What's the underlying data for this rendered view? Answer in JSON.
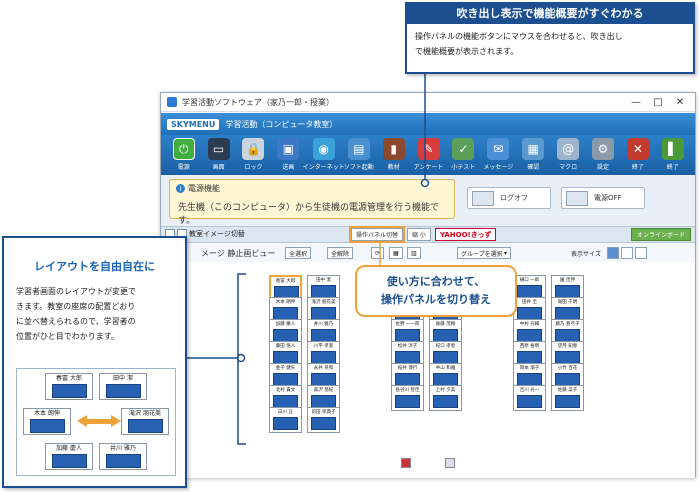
{
  "window": {
    "title": "学習活動ソフトウェア（家乃一郎・授業）",
    "controls": [
      "—",
      "□",
      "✕"
    ],
    "logo": "SKYMENU",
    "mode": "学習活動（コンピュータ教室）"
  },
  "toolbar": {
    "items": [
      {
        "label": "電源",
        "icon": "power-icon",
        "color": "#3fae3f",
        "glyph": "⏻"
      },
      {
        "label": "画面",
        "icon": "monitor-icon",
        "color": "#2a3b52",
        "glyph": "▭"
      },
      {
        "label": "ロック",
        "icon": "lock-icon",
        "color": "#c9d4de",
        "glyph": "🔒"
      },
      {
        "label": "送画",
        "icon": "display-icon",
        "color": "#3c78c4",
        "glyph": "▣"
      },
      {
        "label": "インターネット",
        "icon": "globe-icon",
        "color": "#3aa0d8",
        "glyph": "◉"
      },
      {
        "label": "ソフト起動",
        "icon": "software-icon",
        "color": "#4a90d0",
        "glyph": "▤"
      },
      {
        "label": "教材",
        "icon": "book-icon",
        "color": "#8b4a2f",
        "glyph": "▮"
      },
      {
        "label": "アンケート",
        "icon": "survey-icon",
        "color": "#d63c3c",
        "glyph": "✎"
      },
      {
        "label": "小テスト",
        "icon": "test-icon",
        "color": "#5aa05a",
        "glyph": "✓"
      },
      {
        "label": "メッセージ",
        "icon": "message-icon",
        "color": "#4b8fd6",
        "glyph": "✉"
      },
      {
        "label": "確認",
        "icon": "check-icon",
        "color": "#5a9ad0",
        "glyph": "▦"
      },
      {
        "label": "マクロ",
        "icon": "macro-icon",
        "color": "#9db4cc",
        "glyph": "@"
      },
      {
        "label": "設定",
        "icon": "gear-icon",
        "color": "#8a9aaa",
        "glyph": "⚙"
      },
      {
        "label": "終了",
        "icon": "tools-icon",
        "color": "#c23b2e",
        "glyph": "✕"
      },
      {
        "label": "終了",
        "icon": "exit-icon",
        "color": "#4a9a3a",
        "glyph": "▌"
      }
    ]
  },
  "infopanel": {
    "tooltip_title": "電源機能",
    "tooltip_desc": "先生機（このコンピュータ）から生徒機の電源管理を行う機能です。",
    "logoff_label": "ログオフ",
    "power_off_label": "電源OFF"
  },
  "viewbar": {
    "classroom_image": "教室イメージ切替",
    "panel_switch": "操作パネル切替",
    "shrink": "縮 小",
    "yahoo": "YAHOO!きっず",
    "online": "オンラインボード"
  },
  "contentbar": {
    "title": "メージ  静止画ビュー",
    "select_all": "全選択",
    "deselect_all": "全解除",
    "group_select": "グループを選択",
    "display_size": "表示サイズ"
  },
  "seats": [
    {
      "name": "春冨 大郎"
    },
    {
      "name": "田中 潔"
    },
    {
      "name": "木本 朗伸"
    },
    {
      "name": "滝沢 朋花美"
    },
    {
      "name": "加藤 慶人"
    },
    {
      "name": "井川 雅乃"
    },
    {
      "name": "藤田 悟人"
    },
    {
      "name": "川平 孝潔"
    },
    {
      "name": "金子 健矢"
    },
    {
      "name": "永井 英和"
    },
    {
      "name": "北村 貴文"
    },
    {
      "name": "森沢 悠紀"
    },
    {
      "name": "白川 亘"
    },
    {
      "name": "前田 孝典子"
    },
    {
      "name": "小岡 哲人"
    },
    {
      "name": "大谷 真弓"
    },
    {
      "name": "佐野 一一郎"
    },
    {
      "name": "後藤 茂樹"
    },
    {
      "name": "松井 淳子"
    },
    {
      "name": "紀口 孝恵"
    },
    {
      "name": "桜井 博行"
    },
    {
      "name": "中山 和雅"
    },
    {
      "name": "長谷川 智佳"
    },
    {
      "name": "上村 夕美"
    },
    {
      "name": "樋口 一郎"
    },
    {
      "name": "園 佳伸"
    },
    {
      "name": "田井 圭"
    },
    {
      "name": "堀田 千明"
    },
    {
      "name": "中村 光輔"
    },
    {
      "name": "藤乃 春弓子"
    },
    {
      "name": "西原 裕明"
    },
    {
      "name": "望月 知春"
    },
    {
      "name": "岡本 瑞子"
    },
    {
      "name": "小竹 百花"
    },
    {
      "name": "吉川 光一"
    },
    {
      "name": "佐藤 菜子"
    }
  ],
  "callout_top": {
    "title": "吹き出し表示で機能概要がすぐわかる",
    "line1": "操作パネルの機能ボタンにマウスを合わせると、吹き出し",
    "line2": "で機能概要が表示されます。"
  },
  "callout_left": {
    "title": "レイアウトを自由自在に",
    "line1": "学習者画面のレイアウトが変更で",
    "line2": "きます。教室の座席の配置どおり",
    "line3": "に並べ替えられるので、学習者の",
    "line4": "位置がひと目でわかります。",
    "mini_seats": [
      "春冨 大郎",
      "田中 潔",
      "木本 朗伸",
      "滝沢 朋花美",
      "加藤 慶人",
      "井川 雅乃"
    ]
  },
  "callout_mid": {
    "line1": "使い方に合わせて、",
    "line2": "操作パネルを切り替え"
  },
  "colors": {
    "accent": "#1b4f8f",
    "highlight": "#f1a13a",
    "screen": "#2761b3"
  }
}
